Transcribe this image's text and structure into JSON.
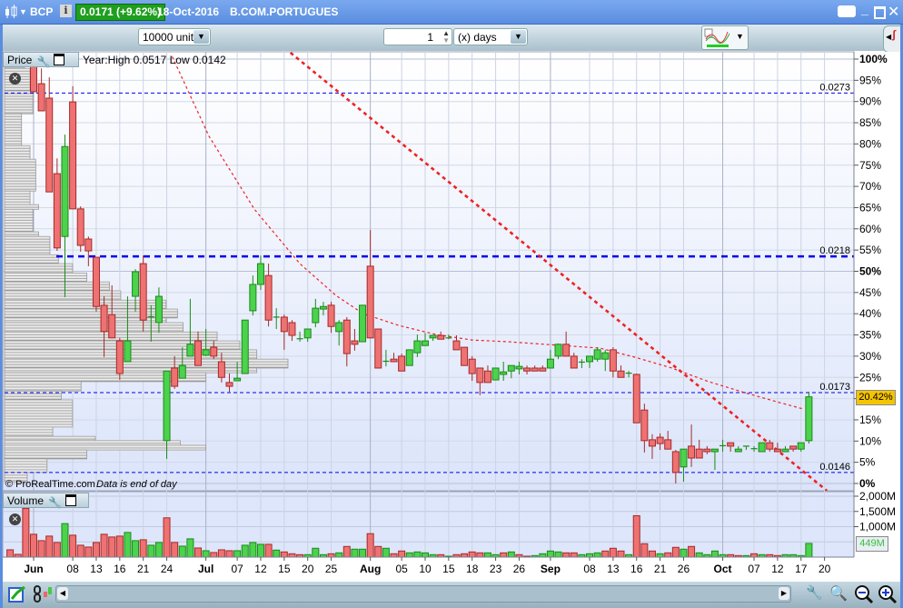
{
  "titlebar": {
    "symbol": "BCP",
    "price_badge": "0.0171 (+9.62%)",
    "date": "18-Oct-2016",
    "name": "B.COM.PORTUGUES"
  },
  "toolbar": {
    "units": "10000 units",
    "period_value": "1",
    "period_unit": "(x) days"
  },
  "price_panel": {
    "label": "Price",
    "info": "Year:High 0.0517 Low 0.0142",
    "copyright": "© ProRealTime.com",
    "data_note": "Data is end of day",
    "current_label": "20.42%",
    "current_pct": 20.42
  },
  "volume_panel": {
    "label": "Volume",
    "current_label": "449M",
    "current_value": 449
  },
  "colors": {
    "up_fill": "#4cd24c",
    "up_stroke": "#1a8a1a",
    "down_fill": "#ef7272",
    "down_stroke": "#a52a2a",
    "level": "#0000ee",
    "ma": "#ee2222",
    "current_bg": "#f5c400"
  },
  "chart_data": {
    "type": "candlestick",
    "y_axis": {
      "unit": "%",
      "range": [
        0,
        100
      ],
      "ticks": [
        "0%",
        "5%",
        "10%",
        "15%",
        "20%",
        "25%",
        "30%",
        "35%",
        "40%",
        "45%",
        "50%",
        "55%",
        "60%",
        "65%",
        "70%",
        "75%",
        "80%",
        "85%",
        "90%",
        "95%",
        "100%"
      ],
      "bold": [
        "0%",
        "50%",
        "100%"
      ]
    },
    "volume_axis": {
      "unit": "M",
      "range": [
        0,
        2100
      ],
      "ticks": [
        {
          "v": 1000,
          "label": "1,000M"
        },
        {
          "v": 1500,
          "label": "1,500M"
        },
        {
          "v": 2000,
          "label": "2,000M"
        }
      ]
    },
    "x_labels": [
      {
        "i": 0,
        "label": "Jun",
        "bold": true
      },
      {
        "i": 5,
        "label": "08"
      },
      {
        "i": 8,
        "label": "13"
      },
      {
        "i": 11,
        "label": "16"
      },
      {
        "i": 14,
        "label": "21"
      },
      {
        "i": 17,
        "label": "24"
      },
      {
        "i": 22,
        "label": "Jul",
        "bold": true
      },
      {
        "i": 26,
        "label": "07"
      },
      {
        "i": 29,
        "label": "12"
      },
      {
        "i": 32,
        "label": "15"
      },
      {
        "i": 35,
        "label": "20"
      },
      {
        "i": 38,
        "label": "25"
      },
      {
        "i": 43,
        "label": "Aug",
        "bold": true
      },
      {
        "i": 47,
        "label": "05"
      },
      {
        "i": 50,
        "label": "10"
      },
      {
        "i": 53,
        "label": "15"
      },
      {
        "i": 56,
        "label": "18"
      },
      {
        "i": 59,
        "label": "23"
      },
      {
        "i": 62,
        "label": "26"
      },
      {
        "i": 66,
        "label": "Sep",
        "bold": true
      },
      {
        "i": 71,
        "label": "08"
      },
      {
        "i": 74,
        "label": "13"
      },
      {
        "i": 77,
        "label": "16"
      },
      {
        "i": 80,
        "label": "21"
      },
      {
        "i": 83,
        "label": "26"
      },
      {
        "i": 88,
        "label": "Oct",
        "bold": true
      },
      {
        "i": 92,
        "label": "07"
      },
      {
        "i": 95,
        "label": "12"
      },
      {
        "i": 98,
        "label": "17"
      },
      {
        "i": 101,
        "label": "20"
      }
    ],
    "levels": [
      {
        "price": "0.0273",
        "pct": 92.0,
        "bold": false
      },
      {
        "price": "0.0218",
        "pct": 53.5,
        "bold": true
      },
      {
        "price": "0.0173",
        "pct": 21.4,
        "bold": false
      },
      {
        "price": "0.0146",
        "pct": 2.6,
        "bold": false
      }
    ],
    "candles_ohlc_pct": [
      [
        99.5,
        100,
        92.3,
        92.3
      ],
      [
        94.2,
        97.8,
        87.8,
        87.8
      ],
      [
        90.8,
        95.7,
        68.7,
        68.7
      ],
      [
        73.0,
        76.6,
        54.8,
        55.5
      ],
      [
        58.2,
        82.2,
        43.9,
        79.4
      ],
      [
        89.9,
        93.6,
        64.7,
        64.7
      ],
      [
        64.7,
        65.3,
        54.6,
        56.1
      ],
      [
        57.6,
        58.2,
        51.2,
        54.8
      ],
      [
        53.3,
        53.3,
        40.5,
        41.7
      ],
      [
        42.0,
        44.1,
        29.8,
        35.8
      ],
      [
        39.8,
        46.7,
        34.3,
        34.3
      ],
      [
        33.6,
        34.3,
        24.4,
        25.9
      ],
      [
        28.7,
        44.1,
        28.7,
        33.6
      ],
      [
        44.1,
        50.5,
        40.5,
        49.9
      ],
      [
        51.8,
        53.7,
        35.8,
        38.5
      ],
      [
        39.2,
        42.0,
        33.4,
        39.3
      ],
      [
        37.9,
        46.2,
        35.5,
        44.1
      ],
      [
        10.1,
        26.5,
        5.8,
        26.5
      ],
      [
        27.2,
        30.0,
        22.3,
        22.9
      ],
      [
        24.8,
        32.1,
        24.8,
        27.8
      ],
      [
        30.0,
        43.5,
        30.0,
        32.8
      ],
      [
        33.6,
        35.8,
        27.8,
        27.8
      ],
      [
        30.2,
        36.4,
        30.0,
        31.5
      ],
      [
        32.1,
        33.6,
        29.3,
        30.0
      ],
      [
        28.7,
        30.8,
        23.8,
        25.0
      ],
      [
        23.8,
        25.9,
        21.6,
        22.9
      ],
      [
        24.2,
        28.7,
        24.2,
        24.8
      ],
      [
        25.9,
        38.5,
        25.9,
        38.5
      ],
      [
        40.7,
        49.0,
        39.6,
        46.9
      ],
      [
        46.9,
        53.7,
        45.6,
        51.8
      ],
      [
        49.0,
        51.8,
        37.0,
        38.5
      ],
      [
        39.1,
        41.3,
        36.4,
        39.2
      ],
      [
        39.2,
        39.8,
        31.5,
        35.8
      ],
      [
        37.9,
        38.5,
        33.6,
        34.9
      ],
      [
        34.0,
        35.8,
        33.4,
        34.1
      ],
      [
        34.3,
        36.4,
        33.4,
        36.4
      ],
      [
        37.9,
        43.5,
        36.8,
        41.3
      ],
      [
        41.1,
        42.8,
        39.6,
        41.7
      ],
      [
        42.0,
        42.8,
        35.5,
        37.0
      ],
      [
        35.8,
        38.5,
        32.5,
        37.9
      ],
      [
        38.5,
        39.2,
        27.6,
        30.6
      ],
      [
        33.6,
        36.4,
        31.3,
        32.8
      ],
      [
        33.4,
        42.0,
        33.4,
        42.0
      ],
      [
        51.2,
        59.7,
        34.3,
        34.3
      ],
      [
        36.4,
        36.4,
        27.2,
        27.2
      ],
      [
        28.7,
        31.5,
        27.6,
        28.8
      ],
      [
        29.3,
        30.8,
        28.7,
        28.7
      ],
      [
        30.0,
        30.6,
        26.5,
        26.5
      ],
      [
        27.8,
        31.5,
        27.8,
        31.5
      ],
      [
        30.8,
        35.1,
        29.8,
        33.6
      ],
      [
        32.5,
        35.5,
        32.5,
        33.6
      ],
      [
        34.3,
        34.9,
        33.6,
        34.9
      ],
      [
        34.9,
        35.8,
        34.0,
        34.0
      ],
      [
        34.3,
        35.1,
        34.0,
        34.3
      ],
      [
        33.6,
        34.9,
        31.5,
        31.5
      ],
      [
        32.1,
        32.1,
        27.8,
        27.8
      ],
      [
        29.3,
        30.0,
        24.2,
        25.9
      ],
      [
        27.2,
        27.2,
        20.8,
        23.8
      ],
      [
        26.5,
        27.8,
        23.8,
        23.8
      ],
      [
        24.4,
        27.2,
        24.4,
        27.2
      ],
      [
        25.7,
        28.7,
        24.2,
        26.3
      ],
      [
        26.5,
        27.8,
        24.8,
        27.8
      ],
      [
        27.0,
        28.7,
        25.7,
        27.6
      ],
      [
        27.2,
        27.8,
        25.7,
        26.5
      ],
      [
        27.2,
        27.8,
        26.5,
        26.5
      ],
      [
        27.2,
        27.8,
        26.5,
        26.5
      ],
      [
        27.2,
        31.5,
        27.2,
        29.3
      ],
      [
        30.0,
        33.0,
        29.3,
        32.8
      ],
      [
        32.8,
        35.8,
        30.0,
        30.0
      ],
      [
        30.0,
        30.8,
        27.2,
        27.2
      ],
      [
        28.5,
        29.3,
        27.2,
        28.6
      ],
      [
        28.7,
        30.0,
        27.2,
        30.0
      ],
      [
        29.3,
        32.1,
        28.7,
        31.5
      ],
      [
        29.3,
        31.5,
        26.5,
        30.8
      ],
      [
        31.5,
        32.1,
        25.0,
        26.5
      ],
      [
        26.5,
        27.8,
        25.0,
        25.0
      ],
      [
        25.9,
        26.5,
        25.0,
        26.0
      ],
      [
        25.7,
        25.9,
        14.3,
        14.3
      ],
      [
        17.3,
        18.8,
        7.3,
        10.1
      ],
      [
        10.3,
        11.6,
        5.8,
        8.8
      ],
      [
        10.9,
        11.8,
        7.9,
        9.4
      ],
      [
        10.3,
        12.4,
        8.1,
        8.1
      ],
      [
        7.5,
        7.9,
        0,
        2.6
      ],
      [
        3.9,
        8.1,
        0.4,
        8.1
      ],
      [
        8.8,
        13.9,
        3.9,
        6.0
      ],
      [
        8.1,
        10.3,
        6.0,
        6.0
      ],
      [
        8.1,
        8.8,
        6.9,
        7.5
      ],
      [
        7.5,
        8.1,
        3.2,
        8.1
      ],
      [
        8.8,
        10.3,
        7.5,
        8.9
      ],
      [
        9.6,
        9.6,
        7.5,
        8.8
      ],
      [
        7.5,
        8.8,
        7.5,
        8.1
      ],
      [
        8.8,
        8.8,
        7.9,
        8.8
      ],
      [
        8.1,
        8.8,
        7.5,
        8.2
      ],
      [
        7.5,
        9.6,
        7.5,
        9.6
      ],
      [
        9.6,
        10.3,
        7.5,
        8.1
      ],
      [
        8.1,
        9.6,
        7.5,
        7.5
      ],
      [
        7.5,
        8.8,
        7.5,
        8.1
      ],
      [
        8.8,
        8.8,
        7.5,
        8.1
      ],
      [
        8.1,
        9.6,
        7.5,
        9.6
      ],
      [
        10.1,
        21.6,
        9.4,
        20.42
      ]
    ],
    "volume_start_index": -3,
    "volume_M": [
      240,
      90,
      1600,
      750,
      540,
      690,
      480,
      1100,
      720,
      390,
      330,
      480,
      750,
      660,
      690,
      810,
      540,
      570,
      390,
      480,
      1290,
      480,
      360,
      600,
      300,
      210,
      150,
      240,
      210,
      210,
      390,
      480,
      420,
      420,
      230,
      170,
      110,
      80,
      80,
      290,
      80,
      110,
      140,
      350,
      260,
      260,
      770,
      350,
      290,
      110,
      200,
      140,
      170,
      140,
      80,
      80,
      30,
      80,
      110,
      170,
      140,
      140,
      80,
      140,
      170,
      80,
      30,
      50,
      110,
      200,
      170,
      140,
      140,
      80,
      110,
      140,
      200,
      290,
      200,
      80,
      1360,
      440,
      200,
      110,
      140,
      320,
      260,
      350,
      140,
      80,
      200,
      80,
      80,
      50,
      50,
      110,
      80,
      80,
      50,
      80,
      80,
      50,
      449
    ],
    "moving_average": [
      [
        17.7,
        100.6
      ],
      [
        22.4,
        81.8
      ],
      [
        28.2,
        64.6
      ],
      [
        34.0,
        51.8
      ],
      [
        38.6,
        44.3
      ],
      [
        42.1,
        40.0
      ],
      [
        46.7,
        37.2
      ],
      [
        51.4,
        35.1
      ],
      [
        56.0,
        33.8
      ],
      [
        60.6,
        33.4
      ],
      [
        67.6,
        32.5
      ],
      [
        72.3,
        31.9
      ],
      [
        76.9,
        29.7
      ],
      [
        81.5,
        27.2
      ],
      [
        86.2,
        24.0
      ],
      [
        90.8,
        21.4
      ],
      [
        95.4,
        19.0
      ],
      [
        98.4,
        17.5
      ]
    ],
    "trendline": [
      [
        32.8,
        101.5
      ],
      [
        101.3,
        -1.7
      ]
    ],
    "volume_profile": [
      [
        97.8,
        100,
        7
      ],
      [
        92.5,
        97.8,
        9
      ],
      [
        87.1,
        92.5,
        10
      ],
      [
        79.6,
        87.1,
        6
      ],
      [
        76.4,
        79.6,
        9
      ],
      [
        68.9,
        76.4,
        11
      ],
      [
        65.7,
        68.9,
        9
      ],
      [
        64.6,
        65.7,
        12
      ],
      [
        59.3,
        64.6,
        10
      ],
      [
        58.2,
        59.3,
        12
      ],
      [
        53.9,
        58.2,
        16
      ],
      [
        51.8,
        53.9,
        19
      ],
      [
        49.6,
        51.8,
        24
      ],
      [
        47.5,
        49.6,
        29
      ],
      [
        45.4,
        47.5,
        37
      ],
      [
        43.2,
        45.4,
        41
      ],
      [
        41.1,
        43.2,
        57
      ],
      [
        39.0,
        41.1,
        61
      ],
      [
        37.9,
        39.0,
        57
      ],
      [
        35.7,
        37.9,
        63
      ],
      [
        33.6,
        35.7,
        75
      ],
      [
        31.5,
        33.6,
        83
      ],
      [
        29.3,
        31.5,
        89
      ],
      [
        27.2,
        29.3,
        100
      ],
      [
        26.1,
        27.2,
        89
      ],
      [
        24.0,
        26.1,
        71
      ],
      [
        21.8,
        24.0,
        27
      ],
      [
        19.7,
        21.8,
        20
      ],
      [
        13.3,
        19.7,
        24
      ],
      [
        11.1,
        13.3,
        17
      ],
      [
        10.1,
        11.1,
        32
      ],
      [
        9.0,
        10.1,
        62
      ],
      [
        7.9,
        9.0,
        71
      ],
      [
        5.8,
        7.9,
        29
      ],
      [
        2.6,
        5.8,
        15
      ],
      [
        0.4,
        2.6,
        8
      ]
    ]
  }
}
